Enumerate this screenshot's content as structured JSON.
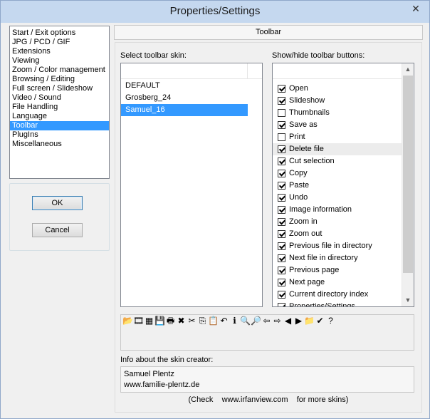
{
  "window": {
    "title": "Properties/Settings",
    "close_glyph": "✕"
  },
  "sidebar": {
    "items": [
      {
        "label": "Start / Exit options"
      },
      {
        "label": "JPG / PCD / GIF"
      },
      {
        "label": "Extensions"
      },
      {
        "label": "Viewing"
      },
      {
        "label": "Zoom / Color management"
      },
      {
        "label": "Browsing / Editing"
      },
      {
        "label": "Full screen / Slideshow"
      },
      {
        "label": "Video / Sound"
      },
      {
        "label": "File Handling"
      },
      {
        "label": "Language"
      },
      {
        "label": "Toolbar",
        "selected": true
      },
      {
        "label": "PlugIns"
      },
      {
        "label": "Miscellaneous"
      }
    ],
    "ok_label": "OK",
    "cancel_label": "Cancel"
  },
  "panel": {
    "header": "Toolbar",
    "skin_label": "Select toolbar skin:",
    "buttons_label": "Show/hide toolbar buttons:",
    "skins": [
      {
        "name": "DEFAULT"
      },
      {
        "name": "Grosberg_24"
      },
      {
        "name": "Samuel_16",
        "selected": true
      }
    ],
    "toolbar_buttons": [
      {
        "label": "Open",
        "checked": true
      },
      {
        "label": "Slideshow",
        "checked": true
      },
      {
        "label": "Thumbnails",
        "checked": false
      },
      {
        "label": "Save as",
        "checked": true
      },
      {
        "label": "Print",
        "checked": false
      },
      {
        "label": "Delete file",
        "checked": true,
        "hover": true
      },
      {
        "label": "Cut selection",
        "checked": true
      },
      {
        "label": "Copy",
        "checked": true
      },
      {
        "label": "Paste",
        "checked": true
      },
      {
        "label": "Undo",
        "checked": true
      },
      {
        "label": "Image information",
        "checked": true
      },
      {
        "label": "Zoom in",
        "checked": true
      },
      {
        "label": "Zoom out",
        "checked": true
      },
      {
        "label": "Previous file in directory",
        "checked": true
      },
      {
        "label": "Next file in directory",
        "checked": true
      },
      {
        "label": "Previous page",
        "checked": true
      },
      {
        "label": "Next page",
        "checked": true
      },
      {
        "label": "Current directory index",
        "checked": true
      },
      {
        "label": "Properties/Settings",
        "checked": true
      }
    ],
    "preview_icons": [
      {
        "icon": "open-folder-icon",
        "glyph": "📂"
      },
      {
        "icon": "slideshow-icon",
        "glyph": "🎞"
      },
      {
        "icon": "thumbnails-icon",
        "glyph": "▦"
      },
      {
        "icon": "save-icon",
        "glyph": "💾"
      },
      {
        "icon": "print-icon",
        "glyph": "🖶"
      },
      {
        "icon": "delete-icon",
        "glyph": "✖"
      },
      {
        "icon": "cut-icon",
        "glyph": "✂"
      },
      {
        "icon": "copy-icon",
        "glyph": "⎘"
      },
      {
        "icon": "paste-icon",
        "glyph": "📋"
      },
      {
        "icon": "undo-icon",
        "glyph": "↶"
      },
      {
        "icon": "info-icon",
        "glyph": "ℹ"
      },
      {
        "icon": "zoom-in-icon",
        "glyph": "🔍"
      },
      {
        "icon": "zoom-out-icon",
        "glyph": "🔎"
      },
      {
        "icon": "previous-file-icon",
        "glyph": "⇦"
      },
      {
        "icon": "next-file-icon",
        "glyph": "⇨"
      },
      {
        "icon": "previous-page-icon",
        "glyph": "◀"
      },
      {
        "icon": "next-page-icon",
        "glyph": "▶"
      },
      {
        "icon": "directory-index-icon",
        "glyph": "📁"
      },
      {
        "icon": "settings-icon",
        "glyph": "✔"
      },
      {
        "icon": "help-icon",
        "glyph": "?"
      }
    ],
    "info_label": "Info about the skin creator:",
    "info_line1": "Samuel Plentz",
    "info_line2": "www.familie-plentz.de",
    "footer": "(Check    www.irfanview.com    for more skins)"
  },
  "colors": {
    "selection": "#3399ff",
    "titlebar": "#c5d8ef"
  }
}
